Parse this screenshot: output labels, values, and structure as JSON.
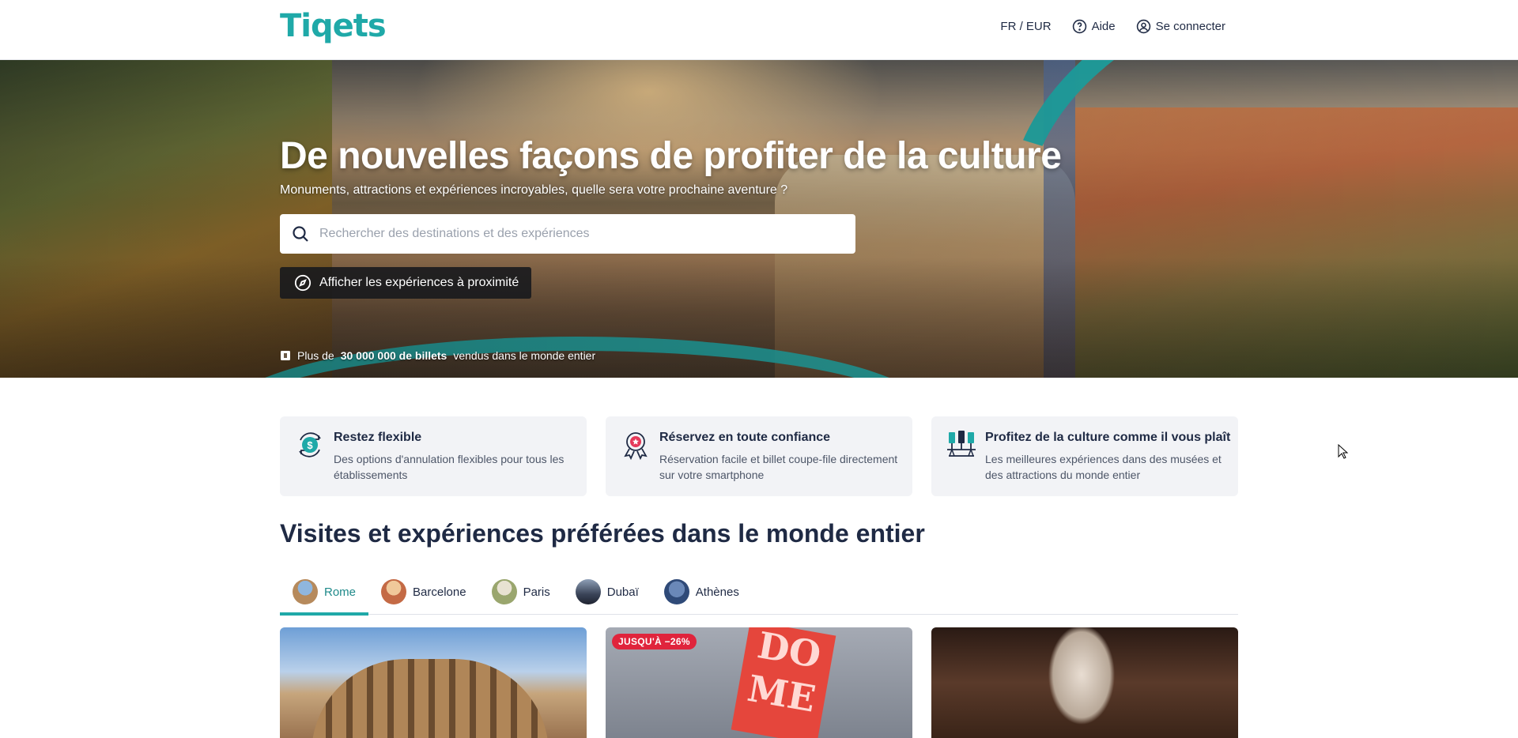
{
  "header": {
    "logo": "Tiqets",
    "locale": "FR / EUR",
    "help": "Aide",
    "login": "Se connecter"
  },
  "hero": {
    "title": "De nouvelles façons de profiter de la culture",
    "subtitle": "Monuments, attractions et expériences incroyables, quelle sera votre prochaine aventure ?",
    "search_placeholder": "Rechercher des destinations et des expériences",
    "nearby_button": "Afficher les expériences à proximité",
    "tickets_prefix": "Plus de",
    "tickets_count": "30 000 000 de billets",
    "tickets_suffix": "vendus dans le monde entier"
  },
  "features": [
    {
      "icon": "flexible-refund-icon",
      "title": "Restez flexible",
      "description": "Des options d'annulation flexibles pour tous les établissements"
    },
    {
      "icon": "trust-badge-icon",
      "title": "Réservez en toute confiance",
      "description": "Réservation facile et billet coupe-file directement sur votre smartphone"
    },
    {
      "icon": "culture-exhibits-icon",
      "title": "Profitez de la culture comme il vous plaît",
      "description": "Les meilleures expériences dans des musées et des attractions du monde entier"
    }
  ],
  "section": {
    "title": "Visites et expériences préférées dans le monde entier",
    "tabs": [
      {
        "label": "Rome",
        "active": true
      },
      {
        "label": "Barcelone",
        "active": false
      },
      {
        "label": "Paris",
        "active": false
      },
      {
        "label": "Dubaï",
        "active": false
      },
      {
        "label": "Athènes",
        "active": false
      }
    ]
  },
  "cards": [
    {
      "badge": ""
    },
    {
      "badge": "JUSQU'À −26%"
    },
    {
      "badge": ""
    }
  ],
  "colors": {
    "brand": "#1fa9a8",
    "text": "#1f2a44",
    "discount": "#e0243c"
  }
}
